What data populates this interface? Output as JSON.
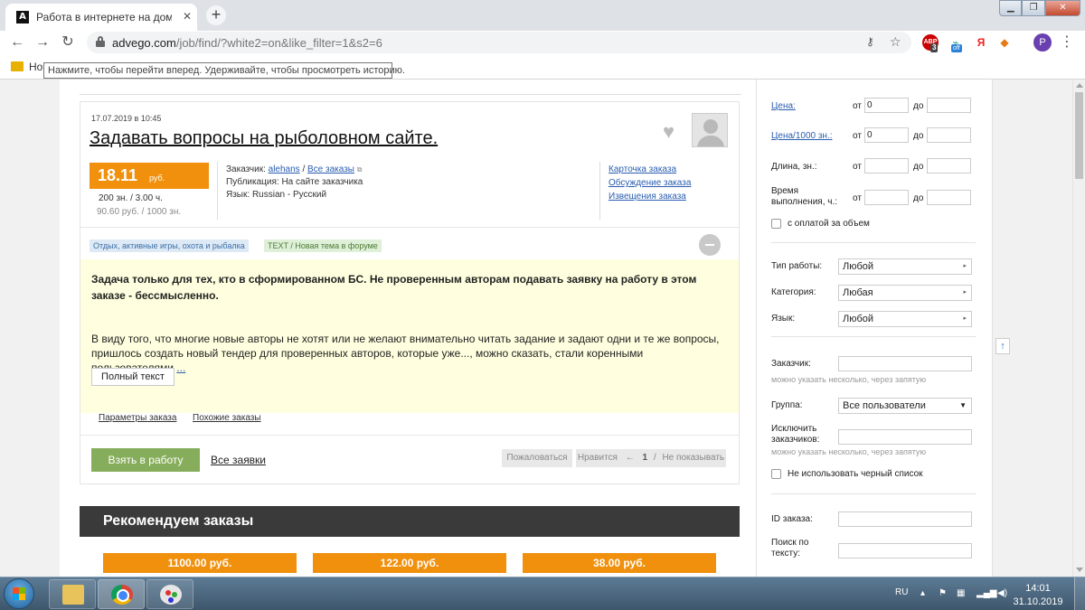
{
  "browser": {
    "tab_title": "Работа в интернете на дому он",
    "tab_favicon": "A",
    "close_glyph": "✕",
    "new_tab_glyph": "+",
    "url_host": "advego.com",
    "url_path": "/job/find/?white2=on&like_filter=1&s2=6",
    "bookmark_label": "Но",
    "tooltip": "Нажмите, чтобы перейти вперед. Удерживайте, чтобы просмотреть историю.",
    "profile_initial": "P",
    "ext_abp_label": "ABP",
    "ext_abp_badge": "3",
    "ext_off_badge": "off",
    "ext_ya": "Я",
    "icons": [
      "back-arrow-icon",
      "forward-arrow-icon",
      "reload-icon",
      "lock-icon",
      "key-icon",
      "star-icon",
      "menu-dots-icon"
    ]
  },
  "job": {
    "date": "17.07.2019 в 10:45",
    "title": "Задавать вопросы на рыболовном сайте.",
    "price": "18.11",
    "currency": "руб.",
    "volume": "200 зн. / 3.00 ч.",
    "price_per_1000": "90.60 руб. / 1000 зн.",
    "customer_label": "Заказчик:",
    "customer_name": "alehans",
    "customer_sep": "/",
    "all_orders": "Все заказы",
    "publication_label": "Публикация:",
    "publication_value": "На сайте заказчика",
    "language_label": "Язык:",
    "language_value": "Russian - Русский",
    "card_link": "Карточка заказа",
    "discussion_link": "Обсуждение заказа",
    "notices_link": "Извещения заказа",
    "tag_category": "Отдых, активные игры, охота и рыбалка",
    "tag_type": "TEXT / Новая тема в форуме",
    "desc_bold": "Задача только для тех, кто в сформированном БС. Не проверенным авторам подавать заявку на работу в этом заказе - бессмысленно.",
    "desc_text": "В виду того, что многие новые авторы не хотят или не желают внимательно читать задание и задают одни и те же вопросы, пришлось создать новый тендер для проверенных авторов, которые уже..., можно сказать, стали коренными пользователями",
    "desc_more": "...",
    "full_text_button": "Полный текст",
    "params_link": "Параметры заказа",
    "similar_link": "Похожие заказы",
    "take_button": "Взять в работу",
    "all_bids_link": "Все заявки",
    "complain_button": "Пожаловаться",
    "like_button": "Нравится",
    "like_arrow": "←",
    "like_count": "1",
    "like_sep": "/",
    "hide_button": "Не показывать"
  },
  "recommend": {
    "title": "Рекомендуем заказы",
    "prices": [
      "1100.00 руб.",
      "122.00 руб.",
      "38.00 руб."
    ]
  },
  "filters": {
    "price_label": "Цена:",
    "price1000_label": "Цена/1000 зн.:",
    "length_label": "Длина, зн.:",
    "time_label": "Время выполнения, ч.:",
    "from": "от",
    "to": "до",
    "price_from_value": "0",
    "price1000_from_value": "0",
    "volume_pay_label": "с оплатой за объем",
    "work_type_label": "Тип работы:",
    "work_type_value": "Любой",
    "category_label": "Категория:",
    "category_value": "Любая",
    "language_label": "Язык:",
    "language_value": "Любой",
    "customer_label": "Заказчик:",
    "customer_hint": "можно указать несколько, через запятую",
    "group_label": "Группа:",
    "group_value": "Все пользователи",
    "exclude_label": "Исключить заказчиков:",
    "exclude_hint": "можно указать несколько, через запятую",
    "no_blacklist_label": "Не использовать черный список",
    "id_label": "ID заказа:",
    "search_label": "Поиск по тексту:",
    "select_arrow": "▸",
    "group_arrow": "▼",
    "up_arrow": "↑"
  },
  "taskbar": {
    "lang": "RU",
    "time": "14:01",
    "date": "31.10.2019"
  }
}
